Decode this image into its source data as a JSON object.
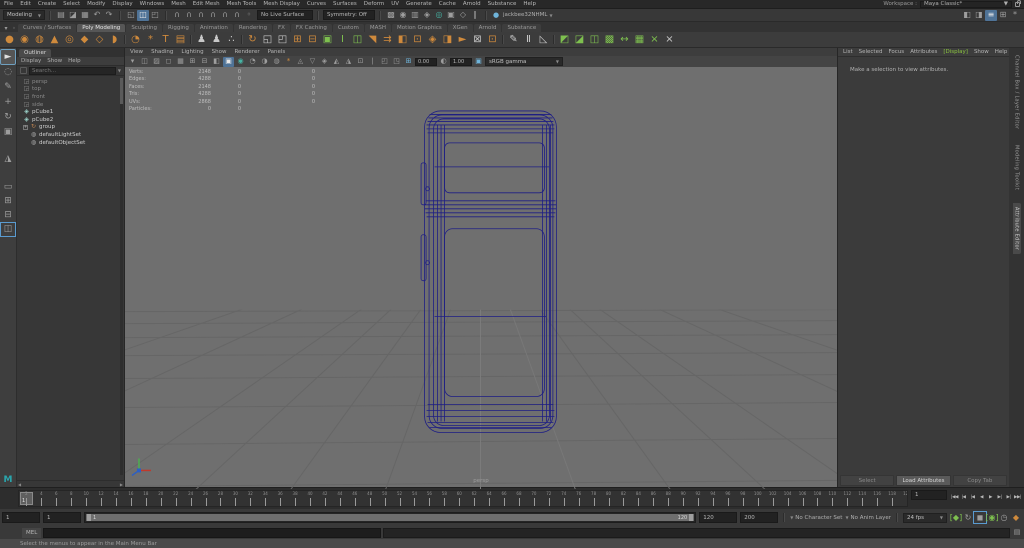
{
  "menu_bar": {
    "items": [
      "File",
      "Edit",
      "Create",
      "Select",
      "Modify",
      "Display",
      "Windows",
      "Mesh",
      "Edit Mesh",
      "Mesh Tools",
      "Mesh Display",
      "Curves",
      "Surfaces",
      "Deform",
      "UV",
      "Generate",
      "Cache",
      "Arnold",
      "Substance",
      "Help"
    ],
    "workspace_label": "Workspace :",
    "workspace_value": "Maya Classic*"
  },
  "status_line": {
    "menuset": "Modeling",
    "file_icons": [
      {
        "n": "new-scene-icon",
        "g": "▤"
      },
      {
        "n": "open-scene-icon",
        "g": "◪"
      },
      {
        "n": "save-scene-icon",
        "g": "▦"
      },
      {
        "n": "undo-icon",
        "g": "↶"
      },
      {
        "n": "redo-icon",
        "g": "↷"
      }
    ],
    "mask_icons": [
      {
        "n": "select-hierarchy-icon",
        "g": "◱"
      },
      {
        "n": "select-object-icon",
        "g": "◫",
        "c": "act"
      },
      {
        "n": "select-component-icon",
        "g": "◰"
      }
    ],
    "snap_icons": [
      {
        "n": "snap-grid-icon",
        "g": "∩"
      },
      {
        "n": "snap-curve-icon",
        "g": "∩"
      },
      {
        "n": "snap-point-icon",
        "g": "∩"
      },
      {
        "n": "snap-projected-center-icon",
        "g": "∩"
      },
      {
        "n": "snap-view-plane-icon",
        "g": "∩"
      },
      {
        "n": "make-live-icon",
        "g": "∩"
      },
      {
        "n": "snap-release-icon",
        "g": "◦"
      }
    ],
    "live_surface": "No Live Surface",
    "symmetry": "Symmetry: Off",
    "render_icons": [
      {
        "n": "render-view-icon",
        "g": "▩"
      },
      {
        "n": "render-current-frame-icon",
        "g": "◉"
      },
      {
        "n": "ipr-render-icon",
        "g": "▥"
      },
      {
        "n": "render-settings-icon",
        "g": "◈"
      },
      {
        "n": "hypershade-icon",
        "g": "◎",
        "c": "teal"
      },
      {
        "n": "light-editor-icon",
        "g": "▣"
      },
      {
        "n": "toon-shader-icon",
        "g": "◇"
      },
      {
        "n": "pause-viewport-icon",
        "g": "∥"
      }
    ],
    "account": "jackbee32NHML",
    "right_icons": [
      {
        "n": "show-hotbox-icon",
        "g": "◧"
      },
      {
        "n": "pose-editor-icon",
        "g": "◨"
      },
      {
        "n": "outliner-toggle-icon",
        "g": "≡",
        "c": "act"
      },
      {
        "n": "panel-layout-icon",
        "g": "⊞"
      },
      {
        "n": "settings-gear-icon",
        "g": "*"
      }
    ]
  },
  "shelf": {
    "corner_icons": [
      {
        "n": "shelf-menu-icon",
        "g": "▾"
      },
      {
        "n": "shelf-edit-icon",
        "g": "◦"
      }
    ],
    "tabs": [
      "Curves / Surfaces",
      "Poly Modeling",
      "Sculpting",
      "Rigging",
      "Animation",
      "Rendering",
      "FX",
      "FX Caching",
      "Custom",
      "MASH",
      "Motion Graphics",
      "XGen",
      "Arnold",
      "Substance"
    ],
    "active_tab": "Poly Modeling",
    "icons": [
      {
        "n": "poly-sphere-icon",
        "g": "●",
        "c": "org"
      },
      {
        "n": "poly-cube-icon",
        "g": "◉",
        "c": "org"
      },
      {
        "n": "poly-cylinder-icon",
        "g": "◍",
        "c": "org"
      },
      {
        "n": "poly-cone-icon",
        "g": "▲",
        "c": "org"
      },
      {
        "n": "poly-torus-icon",
        "g": "◎",
        "c": "org"
      },
      {
        "n": "poly-plane-icon",
        "g": "◆",
        "c": "org"
      },
      {
        "n": "poly-disc-icon",
        "g": "◇",
        "c": "org"
      },
      {
        "n": "poly-gear-icon",
        "g": "◗",
        "c": "org"
      },
      {
        "sep": true
      },
      {
        "n": "platonic-solid-icon",
        "g": "◔",
        "c": "org"
      },
      {
        "n": "super-shape-icon",
        "g": "*",
        "c": "org"
      },
      {
        "n": "poly-text-icon",
        "g": "T",
        "c": "org"
      },
      {
        "n": "svg-icon",
        "g": "▤",
        "c": "org"
      },
      {
        "sep": true
      },
      {
        "n": "sculpt-mesh-icon",
        "g": "♟",
        "c": "lt"
      },
      {
        "n": "character-icon",
        "g": "♟",
        "c": "lt"
      },
      {
        "n": "crowd-icon",
        "g": "∴",
        "c": "lt"
      },
      {
        "sep": true
      },
      {
        "n": "revolve-icon",
        "g": "↻",
        "c": "org"
      },
      {
        "n": "boolean-union-icon",
        "g": "◱",
        "c": "lt"
      },
      {
        "n": "boolean-difference-icon",
        "g": "◰",
        "c": "lt"
      },
      {
        "n": "combine-icon",
        "g": "⊞",
        "c": "org"
      },
      {
        "n": "separate-icon",
        "g": "⊟",
        "c": "org"
      },
      {
        "n": "isolate-select-icon",
        "g": "▣",
        "c": "grn"
      },
      {
        "n": "insert-edge-loop-icon",
        "g": "I",
        "c": "grn"
      },
      {
        "n": "multi-cut-icon",
        "g": "◫",
        "c": "grn"
      },
      {
        "n": "bevel-icon",
        "g": "◥",
        "c": "org"
      },
      {
        "n": "bridge-icon",
        "g": "⇉",
        "c": "org"
      },
      {
        "n": "extrude-icon",
        "g": "◧",
        "c": "org"
      },
      {
        "n": "smooth-icon",
        "g": "⊡",
        "c": "org"
      },
      {
        "n": "mirror-icon",
        "g": "◈",
        "c": "org"
      },
      {
        "n": "wedge-icon",
        "g": "◨",
        "c": "org"
      },
      {
        "n": "duplicate-icon",
        "g": "►",
        "c": "org"
      },
      {
        "n": "delete-edge-icon",
        "g": "⊠",
        "c": "lt"
      },
      {
        "n": "quad-draw-icon",
        "g": "⊡",
        "c": "org"
      },
      {
        "sep": true
      },
      {
        "n": "pencil-curve-icon",
        "g": "✎",
        "c": "lt"
      },
      {
        "n": "sculpt-knife-icon",
        "g": "Ⅱ",
        "c": "lt"
      },
      {
        "n": "slide-edge-icon",
        "g": "◺",
        "c": "lt"
      },
      {
        "sep": true
      },
      {
        "n": "uv-planar-icon",
        "g": "◩",
        "c": "grn"
      },
      {
        "n": "uv-auto-icon",
        "g": "◪",
        "c": "grn"
      },
      {
        "n": "uv-cylindrical-icon",
        "g": "◫",
        "c": "grn"
      },
      {
        "n": "uv-cut-icon",
        "g": "▩",
        "c": "grn"
      },
      {
        "n": "uv-unfold-icon",
        "g": "↔",
        "c": "grn"
      },
      {
        "n": "uv-editor-icon",
        "g": "▦",
        "c": "grn"
      },
      {
        "n": "uv-delete-icon",
        "g": "×",
        "c": "grn"
      },
      {
        "n": "uv-snapshot-icon",
        "g": "×",
        "c": "lt"
      }
    ]
  },
  "toolbox": {
    "tools": [
      {
        "n": "select-tool-icon",
        "g": "►",
        "c": "pressed"
      },
      {
        "n": "lasso-tool-icon",
        "g": "◌"
      },
      {
        "n": "paint-select-tool-icon",
        "g": "✎"
      },
      {
        "n": "move-tool-icon",
        "g": "+"
      },
      {
        "n": "rotate-tool-icon",
        "g": "↻"
      },
      {
        "n": "scale-tool-icon",
        "g": "▣"
      }
    ],
    "extra_tool": {
      "n": "last-tool-icon",
      "g": "◮"
    },
    "layouts": [
      {
        "n": "layout-single-pane-icon",
        "g": "▭"
      },
      {
        "n": "layout-four-pane-icon",
        "g": "⊞"
      },
      {
        "n": "layout-two-pane-icon",
        "g": "⊟"
      },
      {
        "n": "layout-persp-outliner-icon",
        "g": "◫",
        "c": "actb"
      }
    ]
  },
  "outliner": {
    "title": "Outliner",
    "menus": [
      "Display",
      "Show",
      "Help"
    ],
    "search_placeholder": "Search...",
    "items": [
      {
        "label": "persp",
        "glyph": "◲",
        "color": "#8a8a8a",
        "muted": true
      },
      {
        "label": "top",
        "glyph": "◲",
        "color": "#8a8a8a",
        "muted": true
      },
      {
        "label": "front",
        "glyph": "◲",
        "color": "#8a8a8a",
        "muted": true
      },
      {
        "label": "side",
        "glyph": "◲",
        "color": "#8a8a8a",
        "muted": true
      },
      {
        "label": "pCube1",
        "glyph": "◈",
        "color": "#9fd8cf",
        "muted": false
      },
      {
        "label": "pCube2",
        "glyph": "◈",
        "color": "#9fd8cf",
        "muted": false
      },
      {
        "label": "group",
        "glyph": "↻",
        "color": "#c08552",
        "muted": false,
        "expander": true
      },
      {
        "label": "defaultLightSet",
        "glyph": "◍",
        "color": "#a8a8a8",
        "muted": false,
        "indent": true
      },
      {
        "label": "defaultObjectSet",
        "glyph": "◍",
        "color": "#a8a8a8",
        "muted": false,
        "indent": true
      }
    ]
  },
  "viewport": {
    "menus": [
      "View",
      "Shading",
      "Lighting",
      "Show",
      "Renderer",
      "Panels"
    ],
    "toolbar_icons": [
      {
        "n": "select-camera-icon",
        "g": "▾"
      },
      {
        "n": "lock-camera-icon",
        "g": "◫"
      },
      {
        "n": "camera-attributes-icon",
        "g": "▨"
      },
      {
        "n": "bookmarks-icon",
        "g": "◻"
      },
      {
        "n": "image-plane-icon",
        "g": "▦"
      },
      {
        "n": "two-d-pan-icon",
        "g": "⊞"
      },
      {
        "n": "oversan-icon",
        "g": "⊟"
      },
      {
        "n": "grease-pencil-icon",
        "g": "◧"
      },
      {
        "n": "wireframe-mode-icon",
        "g": "▣",
        "c": "act"
      },
      {
        "n": "shaded-mode-icon",
        "g": "◉",
        "c": "teal"
      },
      {
        "n": "textured-mode-icon",
        "g": "◔"
      },
      {
        "n": "lighting-mode-icon",
        "g": "◑"
      },
      {
        "n": "shadows-icon",
        "g": "◍"
      },
      {
        "n": "screen-space-ao-icon",
        "g": "*",
        "c": "org"
      },
      {
        "n": "motion-blur-icon",
        "g": "◬"
      },
      {
        "n": "multisample-icon",
        "g": "▽"
      },
      {
        "n": "depth-peeling-icon",
        "g": "◈"
      },
      {
        "n": "isolate-icon",
        "g": "◭"
      },
      {
        "n": "xray-icon",
        "g": "◮"
      },
      {
        "n": "joints-xray-icon",
        "g": "⊡"
      },
      {
        "n": "separator-icon",
        "g": "∣"
      },
      {
        "n": "plugin-a-icon",
        "g": "◰"
      },
      {
        "n": "plugin-b-icon",
        "g": "◳"
      },
      {
        "n": "grid-toggle-icon",
        "g": "⊞",
        "c": "blu"
      }
    ],
    "exposure": "0.00",
    "gamma": "1.00",
    "colorspace": "sRGB gamma",
    "camera_label": "persp",
    "stats": {
      "rows": [
        {
          "label": "Verts:",
          "values": [
            "2148",
            "0",
            "0"
          ]
        },
        {
          "label": "Edges:",
          "values": [
            "4288",
            "0",
            "0"
          ]
        },
        {
          "label": "Faces:",
          "values": [
            "2148",
            "0",
            "0"
          ]
        },
        {
          "label": "Tris:",
          "values": [
            "4288",
            "0",
            "0"
          ]
        },
        {
          "label": "UVs:",
          "values": [
            "2868",
            "0",
            "0"
          ]
        },
        {
          "label": "Particles:",
          "values": [
            "0",
            "0",
            ""
          ]
        }
      ]
    }
  },
  "attribute_editor": {
    "menus": [
      "List",
      "Selected",
      "Focus",
      "Attributes",
      "Display",
      "Show",
      "Help"
    ],
    "highlight_menu": "Display",
    "message": "Make a selection to view attributes.",
    "buttons": [
      "Select",
      "Load Attributes",
      "Copy Tab"
    ],
    "primary_button": "Load Attributes"
  },
  "side_tabs": [
    "Channel Box / Layer Editor",
    "Modeling Toolkit",
    "Attribute Editor"
  ],
  "active_side_tab": "Attribute Editor",
  "time_slider": {
    "current_frame": "1",
    "range_start": 1,
    "range_end": 120,
    "label_step": 2,
    "playback_buttons": [
      {
        "n": "go-to-start-button",
        "g": "|◀◀"
      },
      {
        "n": "step-back-frame-button",
        "g": "|◀"
      },
      {
        "n": "step-back-key-button",
        "g": "|◀",
        "c": "org"
      },
      {
        "n": "play-backwards-button",
        "g": "◀"
      },
      {
        "n": "play-forwards-button",
        "g": "▶",
        "c": "lt"
      },
      {
        "n": "step-forward-key-button",
        "g": "▶|",
        "c": "org"
      },
      {
        "n": "step-forward-frame-button",
        "g": "▶|"
      },
      {
        "n": "go-to-end-button",
        "g": "▶▶|"
      }
    ]
  },
  "range_slider": {
    "anim_start": "1",
    "playback_start": "1",
    "bar_start_label": "1",
    "bar_end_label": "120",
    "playback_end": "120",
    "anim_end": "200",
    "character_set": "No Character Set",
    "anim_layer": "No Anim Layer",
    "fps": "24 fps",
    "right_icons": [
      {
        "n": "set-keyframe-icon",
        "g": "[◆]",
        "c": "grn"
      },
      {
        "n": "playback-loop-icon",
        "g": "↻"
      },
      {
        "n": "auto-keyframe-icon",
        "g": "◼",
        "c": "actb"
      },
      {
        "n": "mute-audio-icon",
        "g": "[◉]",
        "c": "grn"
      },
      {
        "n": "animation-prefs-clock-icon",
        "g": "◷"
      },
      {
        "n": "anim-key-settings-icon",
        "g": "◆",
        "c": "org"
      }
    ]
  },
  "command_line": {
    "label": "MEL"
  },
  "help_line": {
    "text": "Select the menus to appear in the Main Menu Bar"
  }
}
